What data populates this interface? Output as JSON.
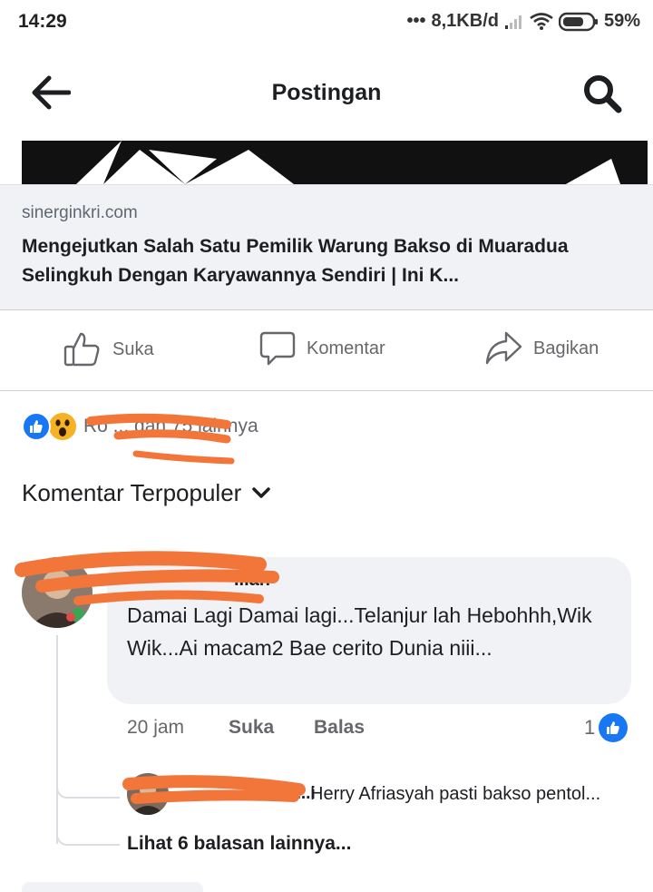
{
  "status_bar": {
    "time": "14:29",
    "network_speed": "8,1KB/d",
    "battery": "59%"
  },
  "app_bar": {
    "title": "Postingan",
    "back_icon": "arrow-left-icon",
    "search_icon": "search-icon"
  },
  "link_preview": {
    "domain": "sinerginkri.com",
    "title": "Mengejutkan Salah Satu Pemilik Warung Bakso di Muaradua Selingkuh Dengan Karyawannya Sendiri | Ini K..."
  },
  "actions": {
    "like_label": "Suka",
    "comment_label": "Komentar",
    "share_label": "Bagikan"
  },
  "reactions": {
    "summary_text": "Ro  ... dan 75 lainnya",
    "icons": [
      "like-reaction-icon",
      "wow-reaction-icon"
    ]
  },
  "sort": {
    "label": "Komentar Terpopuler"
  },
  "comment": {
    "author_visible": "...ah",
    "text": "Damai Lagi Damai lagi...Telanjur lah Hebohhh,Wik Wik...Ai macam2 Bae cerito Dunia niii...",
    "time": "20 jam",
    "like_label": "Suka",
    "reply_label": "Balas",
    "like_count": "1"
  },
  "reply": {
    "author_visible": "...l Y...i",
    "text": "Herry Afriasyah pasti  bakso pentol...",
    "more_label": "Lihat 6 balasan lainnya..."
  },
  "colors": {
    "accent": "#1877f2",
    "redaction": "#f2763a",
    "bubble_bg": "#f0f2f5",
    "secondary_text": "#65676b"
  }
}
